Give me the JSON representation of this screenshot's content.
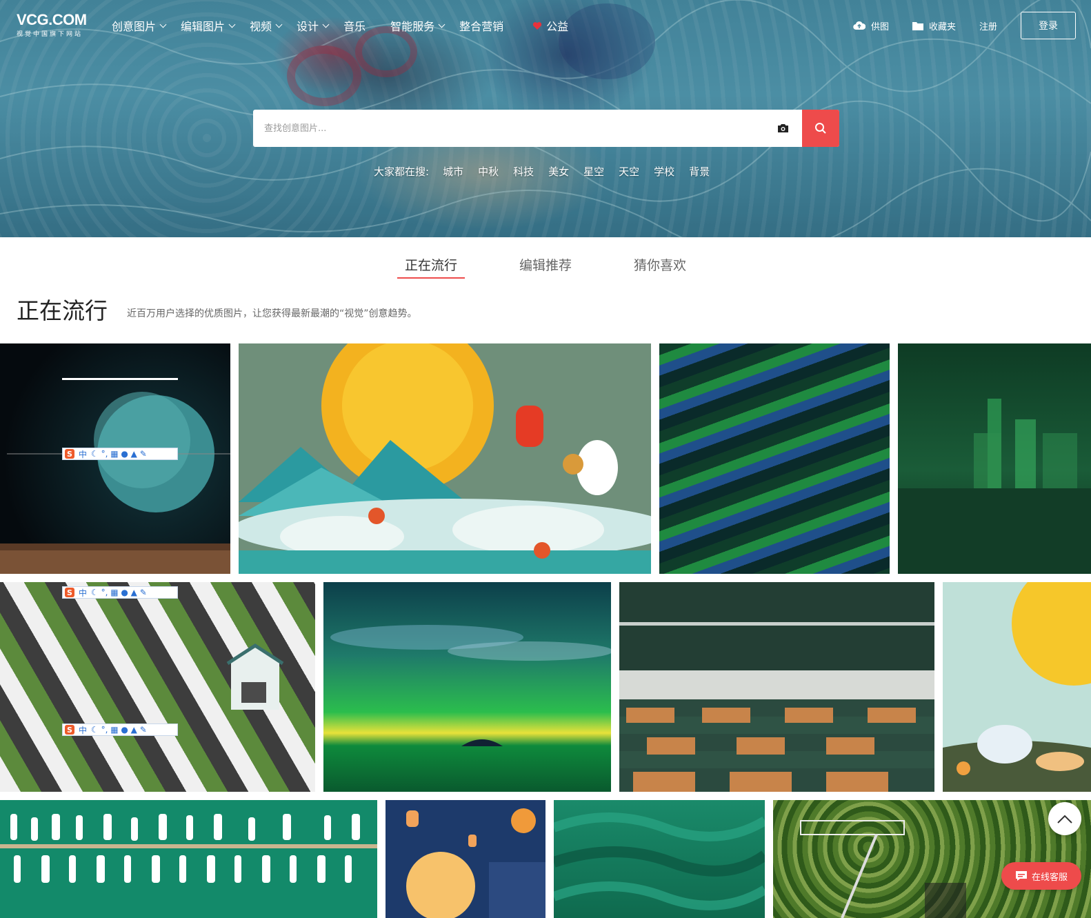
{
  "logo": {
    "main": "VCG.COM",
    "sub": "视觉中国旗下网站"
  },
  "nav": {
    "items": [
      {
        "label": "创意图片",
        "dropdown": true
      },
      {
        "label": "编辑图片",
        "dropdown": true
      },
      {
        "label": "视频",
        "dropdown": true
      },
      {
        "label": "设计",
        "dropdown": true
      },
      {
        "label": "音乐",
        "dropdown": false
      },
      {
        "label": "智能服务",
        "dropdown": true
      },
      {
        "label": "整合营销",
        "dropdown": false
      },
      {
        "label": "公益",
        "dropdown": false,
        "icon": "heart-icon"
      }
    ]
  },
  "right_nav": {
    "upload": {
      "label": "供图",
      "icon": "cloud-upload-icon"
    },
    "favorites": {
      "label": "收藏夹",
      "icon": "folder-icon"
    },
    "register": "注册",
    "login": "登录"
  },
  "search": {
    "placeholder": "查找创意图片...",
    "value": "",
    "camera_icon": "camera-icon",
    "search_icon": "search-icon",
    "button_color": "#ee4b4b"
  },
  "hot_search": {
    "label": "大家都在搜:",
    "tags": [
      "城市",
      "中秋",
      "科技",
      "美女",
      "星空",
      "天空",
      "学校",
      "背景"
    ]
  },
  "tabs": [
    {
      "label": "正在流行",
      "active": true
    },
    {
      "label": "编辑推荐",
      "active": false
    },
    {
      "label": "猜你喜欢",
      "active": false
    }
  ],
  "section": {
    "title": "正在流行",
    "subtitle": "近百万用户选择的优质图片，让您获得最新最潮的“视觉”创意趋势。"
  },
  "ime_toolbar": {
    "lang": "中"
  },
  "floating": {
    "back_to_top_icon": "chevron-up-icon",
    "service_label": "在线客服",
    "service_icon": "chat-icon"
  },
  "colors": {
    "accent": "#ee4b4b"
  }
}
